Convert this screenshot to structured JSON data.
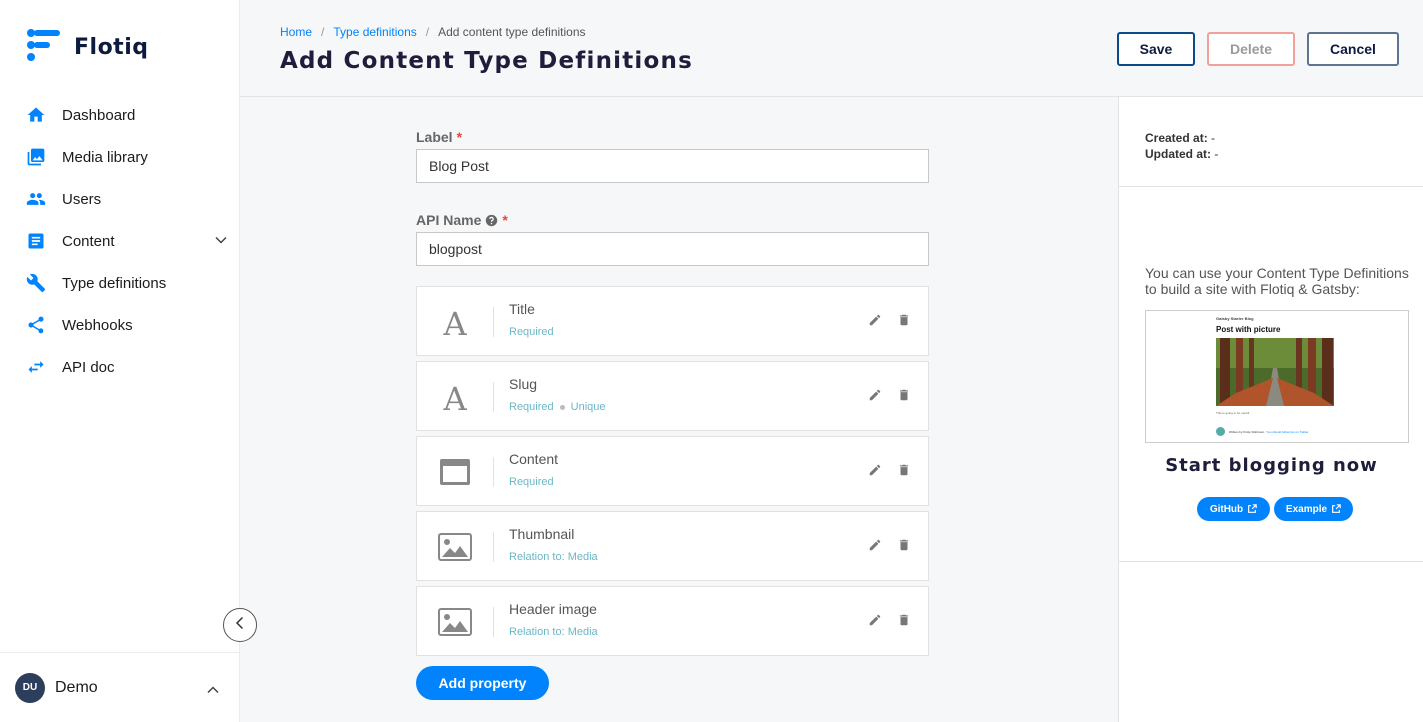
{
  "app": {
    "name": "Flotiq"
  },
  "sidebar": {
    "items": [
      {
        "label": "Dashboard",
        "icon": "home-icon"
      },
      {
        "label": "Media library",
        "icon": "image-library-icon"
      },
      {
        "label": "Users",
        "icon": "users-icon"
      },
      {
        "label": "Content",
        "icon": "document-icon"
      },
      {
        "label": "Type definitions",
        "icon": "wrench-icon"
      },
      {
        "label": "Webhooks",
        "icon": "share-icon"
      },
      {
        "label": "API doc",
        "icon": "swap-arrows-icon"
      }
    ],
    "user": {
      "initials": "DU",
      "name": "Demo"
    }
  },
  "header": {
    "breadcrumb": [
      "Home",
      "Type definitions",
      "Add content type definitions"
    ],
    "breadcrumb_sep": "/",
    "title": "Add Content Type Definitions",
    "save_label": "Save",
    "delete_label": "Delete",
    "cancel_label": "Cancel"
  },
  "form": {
    "label_field": {
      "label": "Label",
      "required_mark": "*",
      "value": "Blog Post"
    },
    "api_name_field": {
      "label": "API Name",
      "required_mark": "*",
      "value": "blogpost"
    },
    "properties": [
      {
        "name": "Title",
        "meta": [
          "Required"
        ],
        "icon": "text-icon"
      },
      {
        "name": "Slug",
        "meta": [
          "Required",
          "Unique"
        ],
        "icon": "text-icon"
      },
      {
        "name": "Content",
        "meta": [
          "Required"
        ],
        "icon": "rich-text-icon"
      },
      {
        "name": "Thumbnail",
        "meta": [
          "Relation to: Media"
        ],
        "icon": "image-icon"
      },
      {
        "name": "Header image",
        "meta": [
          "Relation to: Media"
        ],
        "icon": "image-icon"
      }
    ],
    "add_property_label": "Add property"
  },
  "right_panel": {
    "created_label": "Created at:",
    "created_value": "-",
    "updated_label": "Updated at:",
    "updated_value": "-",
    "promo_text": "You can use your Content Type Definitions to build a site with Flotiq & Gatsby:",
    "preview": {
      "blog_name": "Gatsby Starter Blog",
      "post_title": "Post with picture",
      "body_text": "This is going to be useful",
      "author_text": "Written by Kirsty Robinson",
      "author_link": "You should follow her on Twitter"
    },
    "heading": "Start blogging now",
    "github_label": "GitHub",
    "example_label": "Example"
  },
  "colors": {
    "accent": "#0083fc",
    "navy": "#1e1e3c",
    "danger": "#e0483e",
    "meta_teal": "#6bb7c7"
  }
}
